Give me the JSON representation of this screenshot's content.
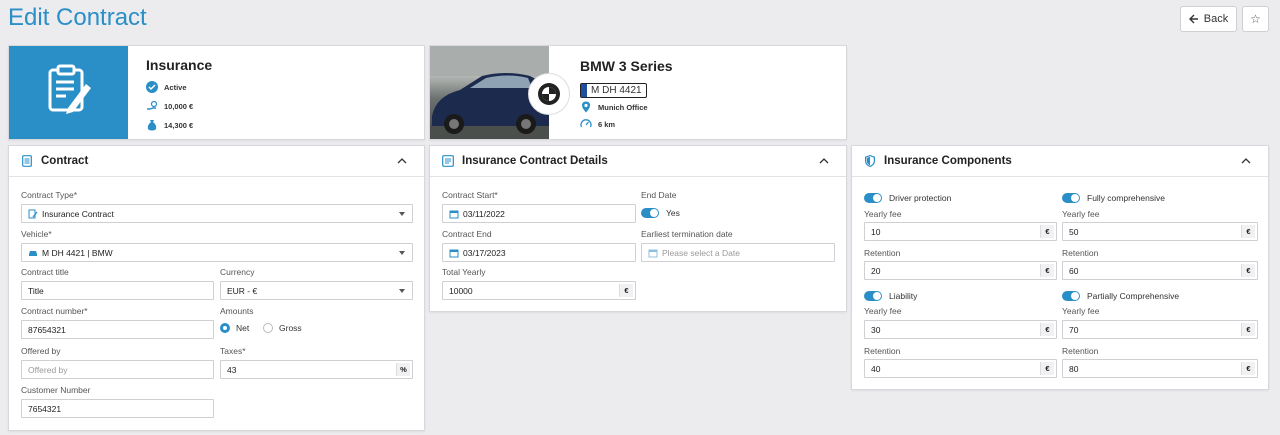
{
  "page": {
    "title": "Edit Contract"
  },
  "header": {
    "back_label": "Back",
    "back_icon": "arrow-left-icon",
    "star_icon": "star-icon"
  },
  "colors": {
    "accent": "#2a8fc7"
  },
  "insurance_card": {
    "title": "Insurance",
    "status": "Active",
    "amount1": "10,000 €",
    "amount2": "14,300 €"
  },
  "vehicle_card": {
    "title": "BMW 3 Series",
    "plate": "M DH 4421",
    "location": "Munich Office",
    "mileage": "6 km"
  },
  "contract_panel": {
    "title": "Contract",
    "contract_type_label": "Contract Type*",
    "contract_type_value": "Insurance Contract",
    "vehicle_label": "Vehicle*",
    "vehicle_value": "M DH 4421 | BMW",
    "contract_title_label": "Contract title",
    "contract_title_value": "Title",
    "currency_label": "Currency",
    "currency_value": "EUR - €",
    "contract_number_label": "Contract number*",
    "contract_number_value": "87654321",
    "amounts_label": "Amounts",
    "amounts_net": "Net",
    "amounts_gross": "Gross",
    "offered_by_label": "Offered by",
    "offered_by_placeholder": "Offered by",
    "taxes_label": "Taxes*",
    "taxes_value": "43",
    "taxes_unit": "%",
    "customer_number_label": "Customer Number",
    "customer_number_value": "7654321"
  },
  "details_panel": {
    "title": "Insurance Contract Details",
    "start_label": "Contract Start*",
    "start_value": "03/11/2022",
    "end_date_label": "End Date",
    "end_date_toggle": "Yes",
    "end_label": "Contract End",
    "end_value": "03/17/2023",
    "termination_label": "Earliest termination date",
    "termination_placeholder": "Please select a Date",
    "total_label": "Total Yearly",
    "total_value": "10000",
    "total_unit": "€"
  },
  "components_panel": {
    "title": "Insurance Components",
    "yearly_fee_label": "Yearly fee",
    "retention_label": "Retention",
    "currency_unit": "€",
    "items": [
      {
        "name": "Driver protection",
        "fee": "10",
        "retention": "20"
      },
      {
        "name": "Fully comprehensive",
        "fee": "50",
        "retention": "60"
      },
      {
        "name": "Liability",
        "fee": "30",
        "retention": "40"
      },
      {
        "name": "Partially Comprehensive",
        "fee": "70",
        "retention": "80"
      }
    ]
  }
}
